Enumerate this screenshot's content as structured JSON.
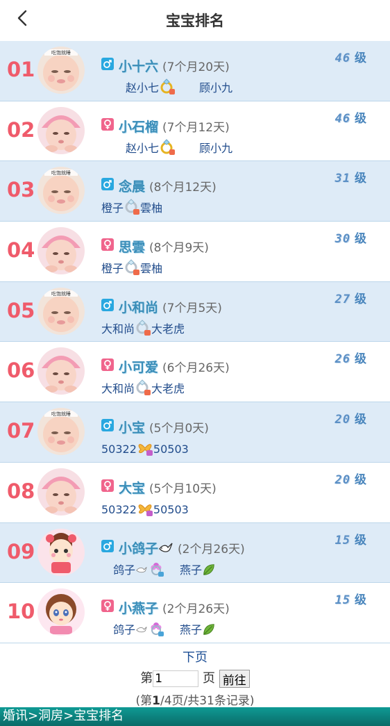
{
  "header": {
    "title": "宝宝排名",
    "back_icon": "chevron-left-icon"
  },
  "colors": {
    "rank": "#ef5b6b",
    "name": "#3a8db8",
    "row_alt": "#deebf7",
    "level": "#4a86bd",
    "boy": "#29a8e0",
    "girl": "#f0648c",
    "footer": "#0a7f7b"
  },
  "rows": [
    {
      "rank": "01",
      "gender": "boy",
      "avatar": "baby-boy",
      "name": "小十六",
      "age": "(7个月20天)",
      "father": "赵小七",
      "ring": "gold",
      "mother": "顾小九",
      "level_num": "46",
      "level_label": "级"
    },
    {
      "rank": "02",
      "gender": "girl",
      "avatar": "baby-girl",
      "name": "小石榴",
      "age": "(7个月12天)",
      "father": "赵小七",
      "ring": "gold",
      "mother": "顾小九",
      "level_num": "46",
      "level_label": "级"
    },
    {
      "rank": "03",
      "gender": "boy",
      "avatar": "baby-boy",
      "name": "念晨",
      "age": "(8个月12天)",
      "father": "橙子",
      "ring": "silver",
      "mother": "雲柚",
      "level_num": "31",
      "level_label": "级"
    },
    {
      "rank": "04",
      "gender": "girl",
      "avatar": "baby-girl",
      "name": "思雲",
      "age": "(8个月9天)",
      "father": "橙子",
      "ring": "silver",
      "mother": "雲柚",
      "level_num": "30",
      "level_label": "级"
    },
    {
      "rank": "05",
      "gender": "boy",
      "avatar": "baby-boy",
      "name": "小和尚",
      "age": "(7个月5天)",
      "father": "大和尚",
      "ring": "silver",
      "mother": "大老虎",
      "level_num": "27",
      "level_label": "级"
    },
    {
      "rank": "06",
      "gender": "girl",
      "avatar": "baby-girl",
      "name": "小可爱",
      "age": "(6个月26天)",
      "father": "大和尚",
      "ring": "silver",
      "mother": "大老虎",
      "level_num": "26",
      "level_label": "级"
    },
    {
      "rank": "07",
      "gender": "boy",
      "avatar": "baby-boy",
      "name": "小宝",
      "age": "(5个月0天)",
      "father": "50322",
      "ring": "butterfly",
      "mother": "50503",
      "level_num": "20",
      "level_label": "级"
    },
    {
      "rank": "08",
      "gender": "girl",
      "avatar": "baby-girl",
      "name": "大宝",
      "age": "(5个月10天)",
      "father": "50322",
      "ring": "butterfly",
      "mother": "50503",
      "level_num": "20",
      "level_label": "级"
    },
    {
      "rank": "09",
      "gender": "boy",
      "avatar": "cartoon-girl",
      "name": "小鸽子",
      "age": "(2个月26天)",
      "father": "鸽子",
      "ring": "flower",
      "mother": "燕子",
      "level_num": "15",
      "level_label": "级",
      "name_icon": "dove-icon"
    },
    {
      "rank": "10",
      "gender": "girl",
      "avatar": "cartoon-doll",
      "name": "小燕子",
      "age": "(2个月26天)",
      "father": "鸽子",
      "ring": "flower",
      "mother": "燕子",
      "level_num": "15",
      "level_label": "级"
    }
  ],
  "pager": {
    "next_label": "下页",
    "goto_prefix": "第",
    "page_value": "1",
    "goto_suffix": "页",
    "go_label": "前往",
    "info_prefix": "(第",
    "current_page": "1",
    "info_suffix": "/4页/共31条记录)"
  },
  "footer": {
    "crumb_1": "婚讯",
    "sep": ">",
    "crumb_2": "洞房",
    "crumb_3": "宝宝排名"
  }
}
